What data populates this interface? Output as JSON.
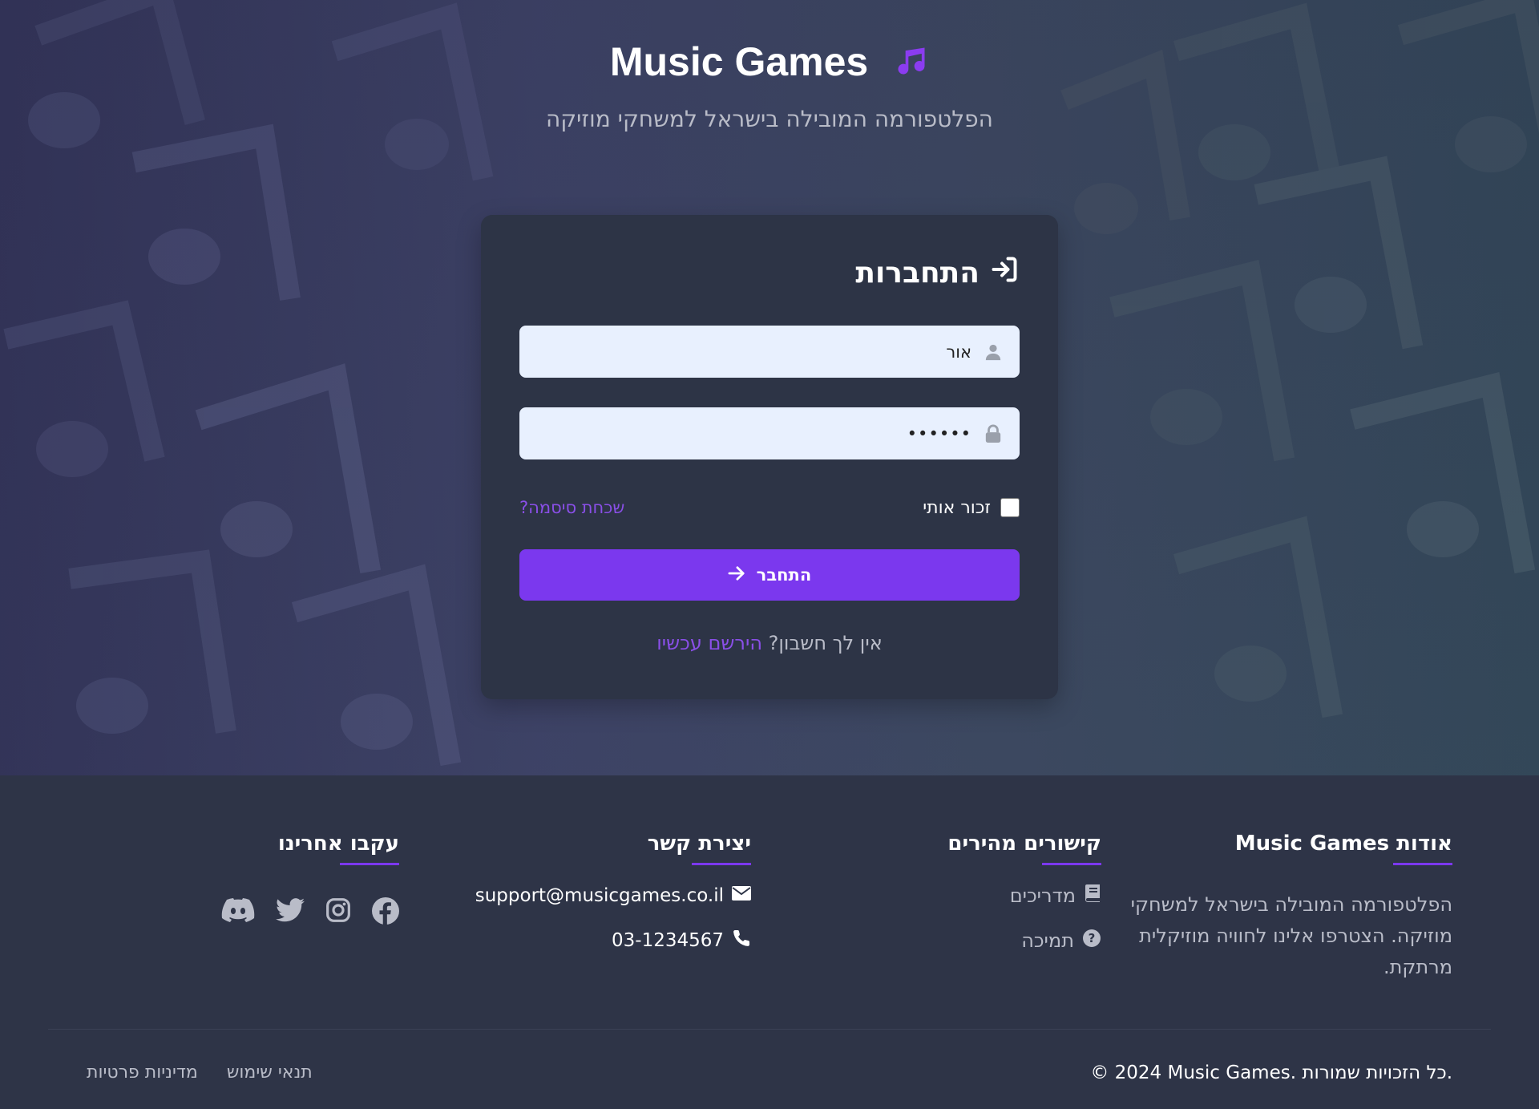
{
  "brand": {
    "title": "Music Games",
    "subtitle": "הפלטפורמה המובילה בישראל למשחקי מוזיקה"
  },
  "login": {
    "title": "התחברות",
    "username_value": "אור",
    "password_value": "••••••",
    "remember_label": "זכור אותי",
    "forgot_label": "שכחת סיסמה?",
    "submit_label": "התחבר",
    "no_account_text": "אין לך חשבון?",
    "register_link": "הירשם עכשיו"
  },
  "footer": {
    "about": {
      "title": "אודות Music Games",
      "text": "הפלטפורמה המובילה בישראל למשחקי מוזיקה. הצטרפו אלינו לחוויה מוזיקלית מרתקת."
    },
    "quick_links": {
      "title": "קישורים מהירים",
      "items": [
        {
          "label": "מדריכים",
          "icon": "book-icon"
        },
        {
          "label": "תמיכה",
          "icon": "question-icon"
        }
      ]
    },
    "contact": {
      "title": "יצירת קשר",
      "email": "support@musicgames.co.il",
      "phone": "03-1234567"
    },
    "follow": {
      "title": "עקבו אחרינו",
      "icons": [
        "facebook-icon",
        "instagram-icon",
        "twitter-icon",
        "discord-icon"
      ]
    },
    "copyright": "© 2024 Music Games. כל הזכויות שמורות.",
    "legal": {
      "terms": "תנאי שימוש",
      "privacy": "מדיניות פרטיות"
    }
  },
  "colors": {
    "accent": "#7b38ee",
    "background": "#2e3447",
    "card": "#2d3446",
    "field": "#e8f0fe"
  }
}
